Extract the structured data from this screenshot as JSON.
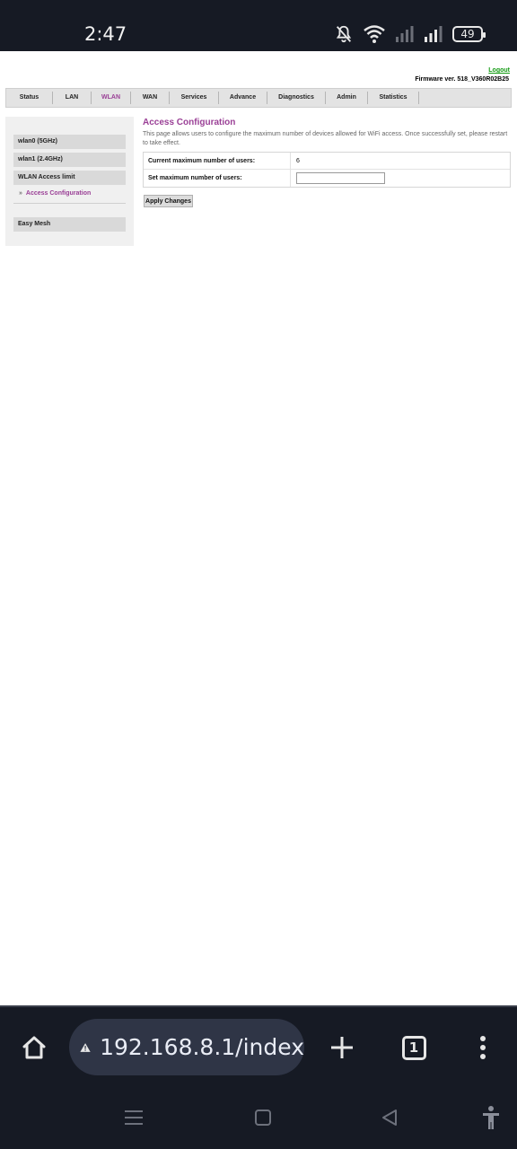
{
  "status_bar": {
    "time": "2:47",
    "battery": "49",
    "icons": [
      "bell-muted-icon",
      "wifi-icon",
      "signal-icon",
      "signal-icon",
      "battery-icon"
    ]
  },
  "router": {
    "logout": "Logout",
    "firmware": "Firmware ver. 518_V360R02B25",
    "nav": [
      {
        "label": "Status",
        "active": false
      },
      {
        "label": "LAN",
        "active": false
      },
      {
        "label": "WLAN",
        "active": true
      },
      {
        "label": "WAN",
        "active": false
      },
      {
        "label": "Services",
        "active": false
      },
      {
        "label": "Advance",
        "active": false
      },
      {
        "label": "Diagnostics",
        "active": false
      },
      {
        "label": "Admin",
        "active": false
      },
      {
        "label": "Statistics",
        "active": false
      }
    ],
    "sidebar": {
      "items": [
        {
          "label": "wlan0 (5GHz)"
        },
        {
          "label": "wlan1 (2.4GHz)"
        },
        {
          "label": "WLAN Access limit"
        }
      ],
      "sub_item": "Access Configuration",
      "easy_mesh": "Easy Mesh"
    },
    "content": {
      "title": "Access Configuration",
      "description": "This page allows users to configure the maximum number of devices allowed for WiFi access. Once successfully set, please restart to take effect.",
      "rows": [
        {
          "label": "Current maximum number of users:",
          "value": "6"
        },
        {
          "label": "Set maximum number of users:",
          "value": ""
        }
      ],
      "apply_button": "Apply Changes"
    },
    "accent_color": "#9a3f96"
  },
  "browser": {
    "url": "192.168.8.1/index",
    "tab_count": "1"
  }
}
